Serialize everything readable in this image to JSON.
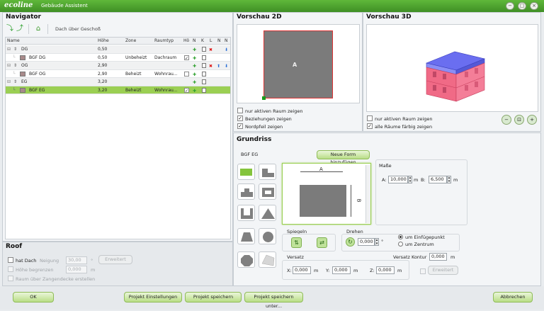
{
  "window": {
    "logo": "ecoline",
    "title": "Gebäude Assistent",
    "buttons": [
      "−",
      "▢",
      "×"
    ]
  },
  "navigator": {
    "title": "Navigator",
    "toolbar_label": "Dach über Geschoß",
    "columns": [
      "Name",
      "Höhe",
      "Zone",
      "Raumtyp",
      "Hö",
      "N",
      "K",
      "L",
      "N",
      "N"
    ],
    "rows": [
      {
        "name": "DG",
        "height": "0,50",
        "zone": "",
        "type": ""
      },
      {
        "name": "BGF DG",
        "height": "0,50",
        "zone": "Unbeheizt",
        "type": "Dachraum"
      },
      {
        "name": "OG",
        "height": "2,90",
        "zone": "",
        "type": ""
      },
      {
        "name": "BGF OG",
        "height": "2,90",
        "zone": "Beheizt",
        "type": "Wohnrau..."
      },
      {
        "name": "EG",
        "height": "3,20",
        "zone": "",
        "type": ""
      },
      {
        "name": "BGF EG",
        "height": "3,20",
        "zone": "Beheizt",
        "type": "Wohnrau..."
      }
    ]
  },
  "roof": {
    "title": "Roof",
    "hat_dach": "hat Dach",
    "neigung": "Neigung",
    "neigung_value": "30,00",
    "neigung_unit": "°",
    "erweitert": "Erweitert",
    "hoehe": "Höhe begrenzen",
    "hoehe_value": "0,000",
    "hoehe_unit": "m",
    "raum": "Raum über Zangendecke erstellen"
  },
  "preview2d": {
    "title": "Vorschau 2D",
    "label_a": "A",
    "options": [
      "nur aktiven Raum zeigen",
      "Beziehungen zeigen",
      "Nordpfeil zeigen"
    ],
    "checked": [
      false,
      true,
      true
    ]
  },
  "preview3d": {
    "title": "Vorschau 3D",
    "options": [
      "nur aktiven Raum zeigen",
      "alle Räume färbig zeigen"
    ],
    "checked": [
      false,
      true
    ]
  },
  "grundriss": {
    "title": "Grundriss",
    "room": "BGF EG",
    "new_shape": "Neue Form hinzufügen",
    "dim_a": "A",
    "dim_b": "B",
    "masse": "Maße",
    "a_label": "A:",
    "a_value": "10,000",
    "b_label": "B:",
    "b_value": "6,500",
    "unit": "m",
    "spiegeln": "Spiegeln",
    "drehen": "Drehen",
    "drehen_value": "0,000",
    "drehen_unit": "°",
    "um_einfuege": "um Einfügepunkt",
    "um_zentrum": "um Zentrum",
    "versatz": "Versatz",
    "versatz_kontur": "Versatz Kontur",
    "kontur_value": "0,000",
    "x_label": "X:",
    "x_value": "0,000",
    "y_label": "Y:",
    "y_value": "0,000",
    "z_label": "Z:",
    "z_value": "0,000",
    "erweitert": "Erweitert"
  },
  "footer": {
    "ok": "OK",
    "settings": "Projekt Einstellungen",
    "save": "Projekt speichern",
    "save_as": "Projekt speichern unter...",
    "cancel": "Abbrechen"
  },
  "colors": {
    "accent": "#5fb83a",
    "selected_row": "#9bcf53",
    "building": "#f06a86",
    "roof": "#6a6ef0"
  }
}
